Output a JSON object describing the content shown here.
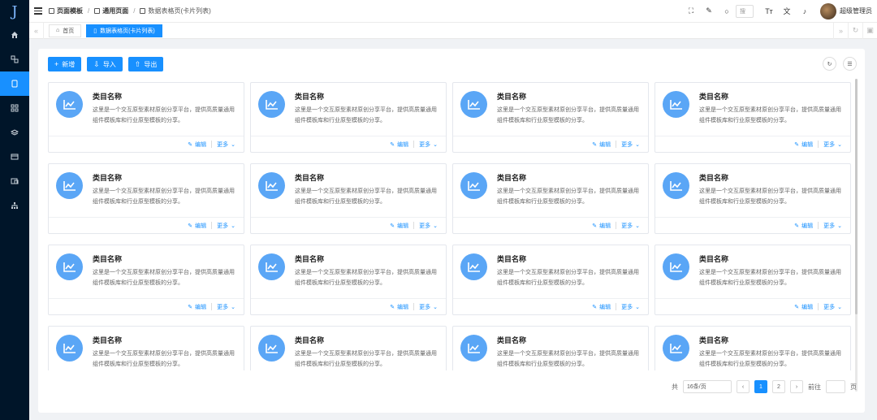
{
  "sidebar": {
    "logo": "J",
    "items": [
      {
        "icon": "home-icon"
      },
      {
        "icon": "layers-icon"
      },
      {
        "icon": "document-icon",
        "active": true
      },
      {
        "icon": "grid-icon"
      },
      {
        "icon": "stack-icon"
      },
      {
        "icon": "window-icon"
      },
      {
        "icon": "image-icon"
      },
      {
        "icon": "sitemap-icon"
      }
    ]
  },
  "header": {
    "breadcrumb": [
      "页面模板",
      "通用页面",
      "数据表格页(卡片列表)"
    ],
    "search_placeholder": "搜",
    "username": "超级管理员"
  },
  "tabs": [
    {
      "label": "首页",
      "active": false
    },
    {
      "label": "数据表格页(卡片列表)",
      "active": true
    }
  ],
  "toolbar": {
    "add_label": "新增",
    "import_label": "导入",
    "export_label": "导出"
  },
  "card": {
    "title": "类目名称",
    "description": "这里是一个交互原型素材原创分享平台，提供高质量通用组件模板库和行业原型模板的分享。",
    "edit_label": "编辑",
    "more_label": "更多"
  },
  "card_count": 16,
  "pagination": {
    "total_text": "共",
    "page_size": "16条/页",
    "current_page": "1",
    "next_page": "2",
    "goto_label": "前往",
    "page_unit": "页"
  },
  "colors": {
    "primary": "#1890ff",
    "sidebar_bg": "#001529",
    "icon_bg": "#5aa6f6"
  }
}
